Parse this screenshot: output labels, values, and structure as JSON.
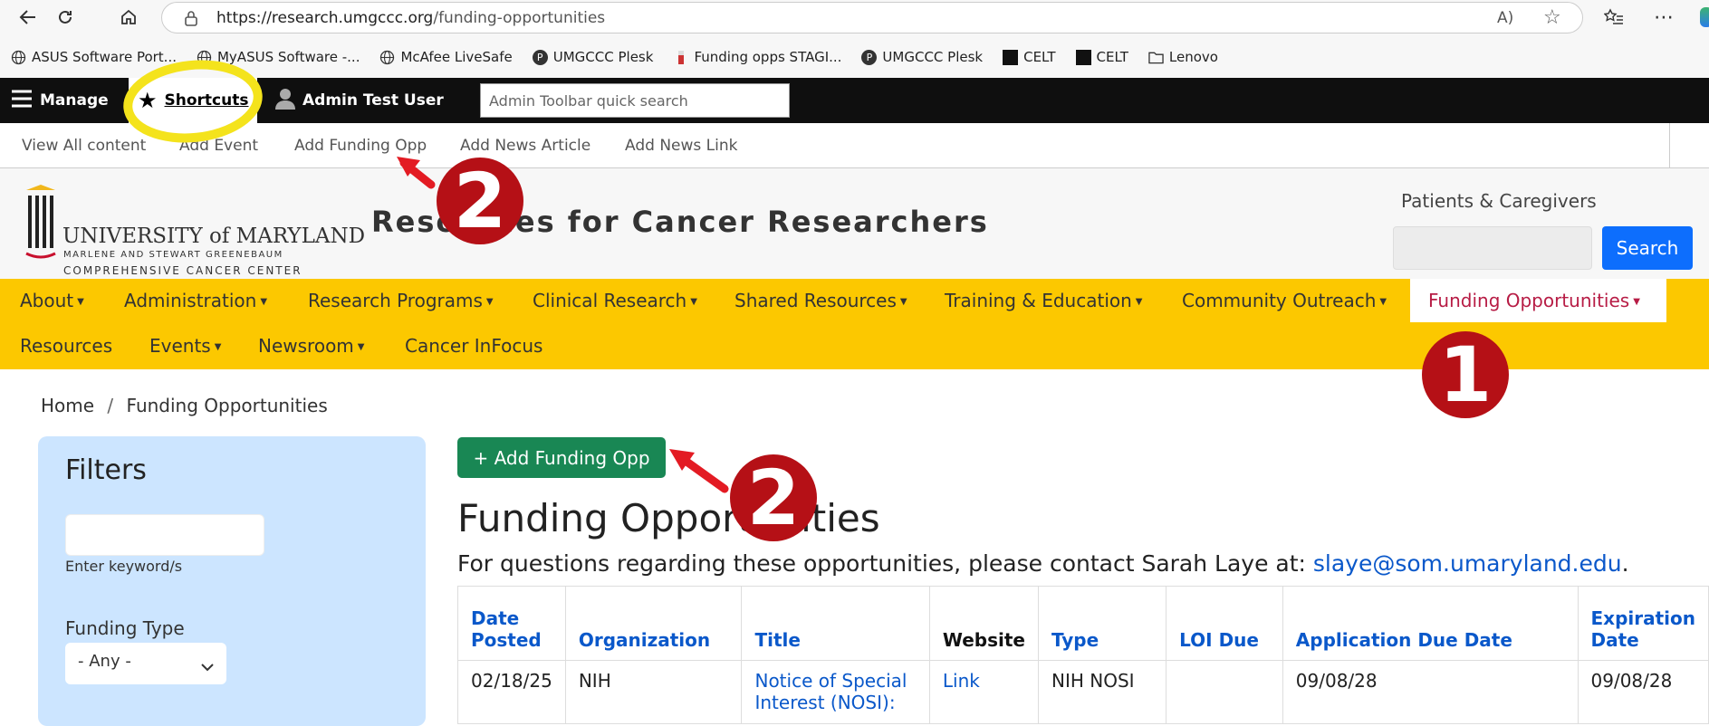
{
  "browser": {
    "url_host": "https://research.umgccc.org",
    "url_path": "/funding-opportunities",
    "bookmarks": [
      "ASUS Software Port...",
      "MyASUS Software -...",
      "McAfee LiveSafe",
      "UMGCCC Plesk",
      "Funding opps STAGI...",
      "UMGCCC Plesk",
      "CELT",
      "CELT",
      "Lenovo"
    ]
  },
  "admin": {
    "manage": "Manage",
    "shortcuts": "Shortcuts",
    "user": "Admin Test User",
    "quicksearch_placeholder": "Admin Toolbar quick search"
  },
  "shortcuts": [
    "View All content",
    "Add Event",
    "Add Funding Opp",
    "Add News Article",
    "Add News Link"
  ],
  "header": {
    "logo_main": "UNIVERSITY of MARYLAND",
    "logo_sub1": "MARLENE AND STEWART GREENEBAUM",
    "logo_sub2": "COMPREHENSIVE CANCER CENTER",
    "site_title": "Resources for Cancer Researchers",
    "patients_link": "Patients & Caregivers",
    "search_btn": "Search"
  },
  "mainnav": {
    "row1": [
      "About",
      "Administration",
      "Research Programs",
      "Clinical Research",
      "Shared Resources",
      "Training & Education",
      "Community Outreach",
      "Funding Opportunities"
    ],
    "row2": [
      "Resources",
      "Events",
      "Newsroom",
      "Cancer InFocus"
    ]
  },
  "breadcrumb": {
    "home": "Home",
    "sep": "/",
    "current": "Funding Opportunities"
  },
  "filters": {
    "heading": "Filters",
    "keyword_label": "Enter keyword/s",
    "type_label": "Funding Type",
    "type_value": "- Any -"
  },
  "content": {
    "add_button": "+ Add Funding Opp",
    "heading": "Funding Opportunities",
    "intro": "For questions regarding these opportunities, please contact Sarah Laye at: ",
    "email": "slaye@som.umaryland.edu",
    "columns": [
      "Date Posted",
      "Organization",
      "Title",
      "Website",
      "Type",
      "LOI Due",
      "Application Due Date",
      "Expiration Date"
    ],
    "row1": {
      "date": "02/18/25",
      "org": "NIH",
      "title": "Notice of Special Interest (NOSI):",
      "website": "Link",
      "type": "NIH NOSI",
      "loi": "",
      "app_due": "09/08/28",
      "expiration": "09/08/28"
    }
  },
  "annotations": {
    "marker1": "1",
    "marker2": "2"
  },
  "colors": {
    "nav_yellow": "#fcc800",
    "accent_red": "#b51016",
    "annotation_yellow": "#f4e31c",
    "link_blue": "#0a58ca",
    "add_green": "#198754"
  }
}
